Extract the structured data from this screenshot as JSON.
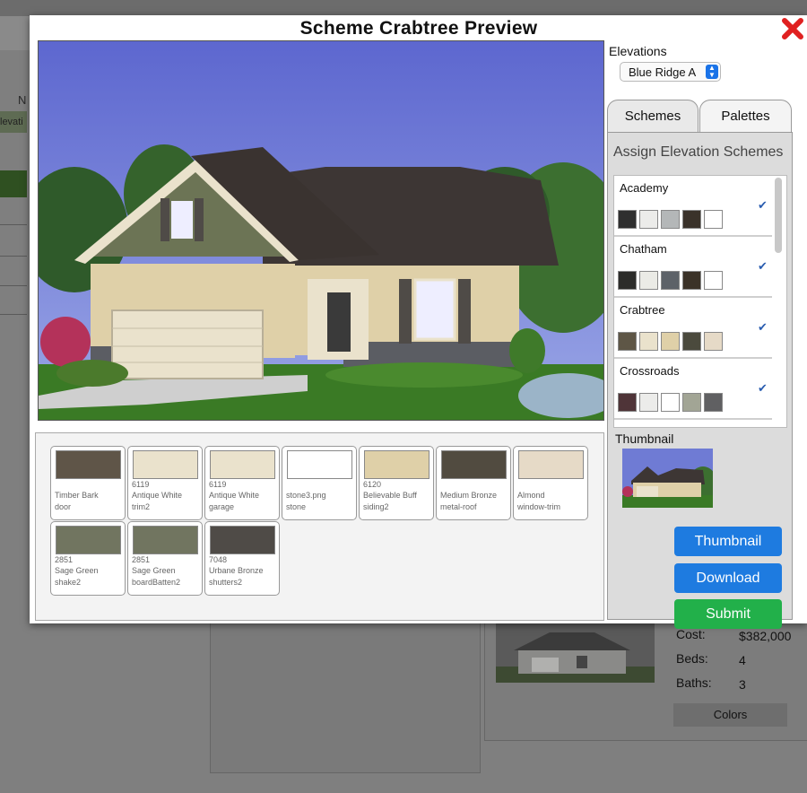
{
  "background": {
    "partial_letter": "N",
    "partial_tab": "levati",
    "cost_label": "Cost:",
    "cost_value": "$382,000",
    "beds_label": "Beds:",
    "beds_value": "4",
    "baths_label": "Baths:",
    "baths_value": "3",
    "colors_button": "Colors"
  },
  "modal": {
    "title": "Scheme Crabtree Preview",
    "close_icon": "close-x-icon",
    "close_color": "#e02020"
  },
  "swatches": [
    {
      "code": "",
      "name": "Timber Bark",
      "part": "door",
      "color": "#5f5548"
    },
    {
      "code": "6119",
      "name": "Antique White",
      "part": "trim2",
      "color": "#eae2cc"
    },
    {
      "code": "6119",
      "name": "Antique White",
      "part": "garage",
      "color": "#eae2cc"
    },
    {
      "code": "",
      "name": "stone3.png",
      "part": "stone",
      "color": "#ffffff"
    },
    {
      "code": "6120",
      "name": "Believable Buff",
      "part": "siding2",
      "color": "#dfd0a8"
    },
    {
      "code": "",
      "name": "Medium Bronze",
      "part": "metal-roof",
      "color": "#514b40"
    },
    {
      "code": "",
      "name": "Almond",
      "part": "window-trim",
      "color": "#e6dac7"
    },
    {
      "code": "2851",
      "name": "Sage Green",
      "part": "shake2",
      "color": "#717560"
    },
    {
      "code": "2851",
      "name": "Sage Green",
      "part": "boardBatten2",
      "color": "#717560"
    },
    {
      "code": "7048",
      "name": "Urbane Bronze",
      "part": "shutters2",
      "color": "#4f4b47"
    }
  ],
  "elevations": {
    "label": "Elevations",
    "selected": "Blue Ridge A"
  },
  "tabs": [
    {
      "label": "Schemes",
      "active": true
    },
    {
      "label": "Palettes",
      "active": false
    }
  ],
  "panel": {
    "title": "Assign Elevation Schemes",
    "check_icon": "checkmark-icon",
    "schemes": [
      {
        "name": "Academy",
        "checked": true,
        "colors": [
          "#2f2f2f",
          "#ececea",
          "#b4b7b8",
          "#3a322a",
          "#ffffff"
        ]
      },
      {
        "name": "Chatham",
        "checked": true,
        "colors": [
          "#2c2c2a",
          "#ebebe6",
          "#5d6268",
          "#3b3228",
          "#ffffff"
        ]
      },
      {
        "name": "Crabtree",
        "checked": true,
        "colors": [
          "#5e5646",
          "#eae2cc",
          "#dfd0a8",
          "#4b4a3d",
          "#e6dac7"
        ]
      },
      {
        "name": "Crossroads",
        "checked": true,
        "colors": [
          "#4f3438",
          "#ececea",
          "#ffffff",
          "#a2a595",
          "#606062"
        ]
      }
    ],
    "thumbnail_label": "Thumbnail"
  },
  "buttons": {
    "thumbnail": "Thumbnail",
    "download": "Download",
    "submit": "Submit"
  }
}
